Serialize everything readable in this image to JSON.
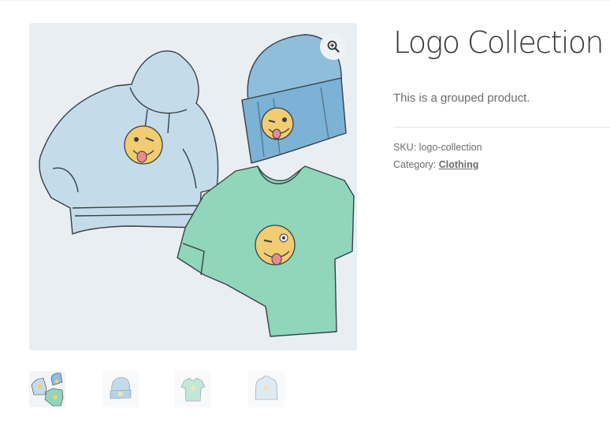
{
  "product": {
    "title": "Logo Collection",
    "short_description": "This is a grouped product.",
    "meta": {
      "sku_label": "SKU:",
      "sku_value": "logo-collection",
      "category_label": "Category:",
      "category_value": "Clothing"
    }
  },
  "gallery": {
    "main_image": "logo-collection-hoodie-beanie-tshirt",
    "zoom_icon": "magnifier-plus-icon",
    "thumbnails": [
      {
        "name": "logo-collection",
        "active": true
      },
      {
        "name": "beanie-with-logo",
        "active": false
      },
      {
        "name": "tshirt-with-logo",
        "active": false
      },
      {
        "name": "hoodie-with-logo",
        "active": false
      }
    ]
  },
  "colors": {
    "hoodie": "#c4dcea",
    "beanie": "#8fbedc",
    "tshirt": "#8fd6bb",
    "emoji": "#f2cc72",
    "tongue": "#e98a8e",
    "outline": "#3a3f47",
    "background": "#e9eef3"
  }
}
